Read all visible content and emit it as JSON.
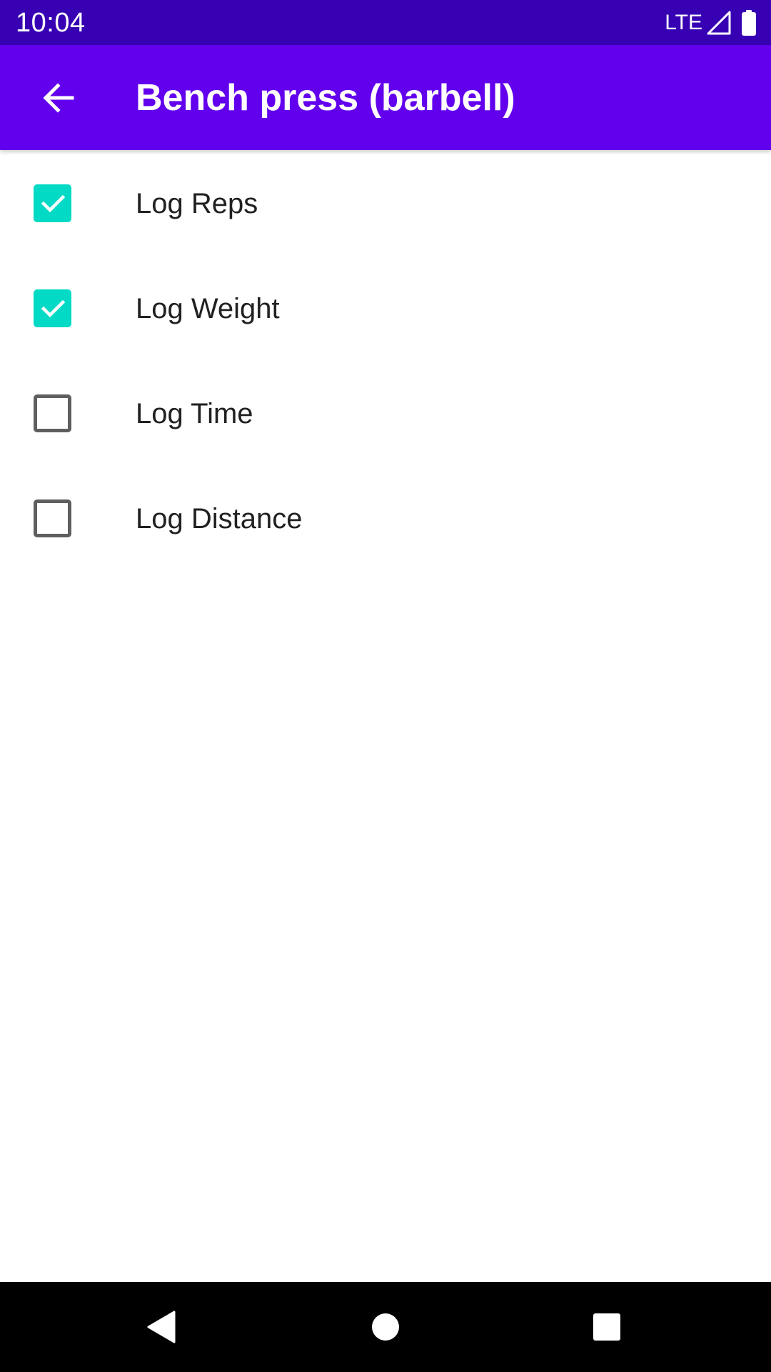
{
  "status_bar": {
    "time": "10:04",
    "network": "LTE",
    "background_color": "#3700b3"
  },
  "app_bar": {
    "title": "Bench press (barbell)",
    "back_icon": "arrow-back-icon",
    "background_color": "#6200ee"
  },
  "options": [
    {
      "label": "Log Reps",
      "checked": true
    },
    {
      "label": "Log Weight",
      "checked": true
    },
    {
      "label": "Log Time",
      "checked": false
    },
    {
      "label": "Log Distance",
      "checked": false
    }
  ],
  "colors": {
    "checkbox_checked": "#03dac5",
    "checkbox_unchecked_border": "#5f5f5f"
  },
  "nav_bar": {
    "buttons": [
      "back-triangle-icon",
      "home-circle-icon",
      "recents-square-icon"
    ]
  }
}
